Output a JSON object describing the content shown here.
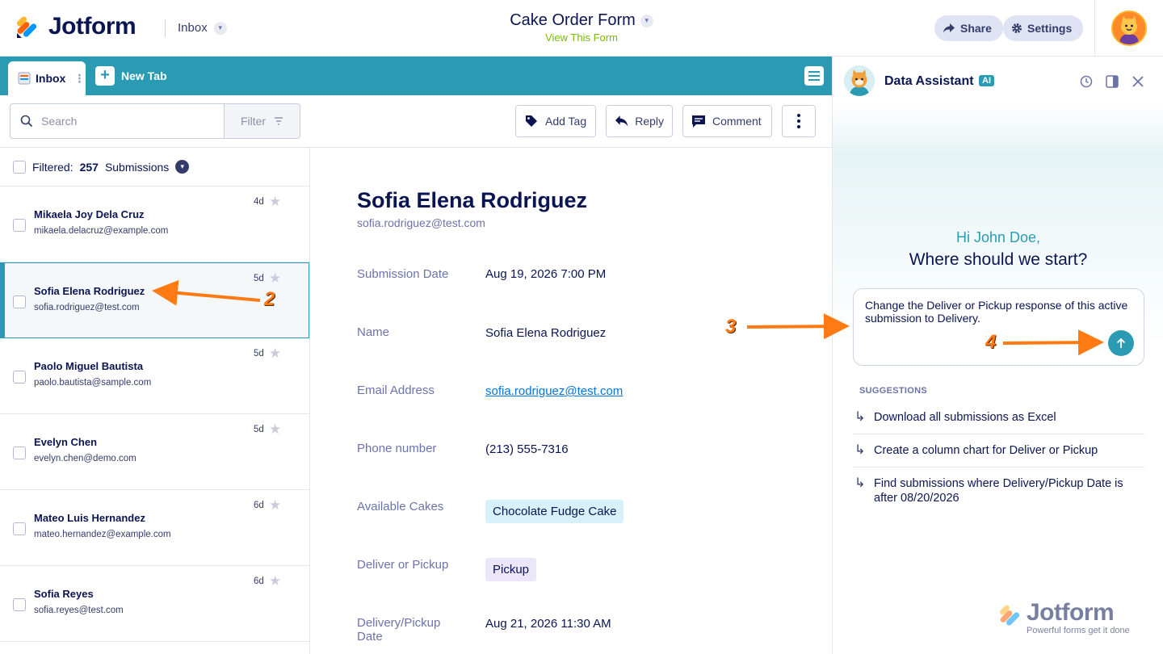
{
  "header": {
    "brand": "Jotform",
    "inbox_label": "Inbox",
    "form_title": "Cake Order Form",
    "view_form": "View This Form",
    "share_label": "Share",
    "settings_label": "Settings"
  },
  "tabs": {
    "active_label": "Inbox",
    "new_tab_label": "New Tab"
  },
  "toolbar": {
    "search_placeholder": "Search",
    "filter_label": "Filter",
    "add_tag_label": "Add Tag",
    "reply_label": "Reply",
    "comment_label": "Comment"
  },
  "list": {
    "filtered_prefix": "Filtered:",
    "count": "257",
    "submissions_suffix": "Submissions",
    "items": [
      {
        "name": "Mikaela Joy Dela Cruz",
        "email": "mikaela.delacruz@example.com",
        "age": "4d"
      },
      {
        "name": "Sofia Elena Rodriguez",
        "email": "sofia.rodriguez@test.com",
        "age": "5d"
      },
      {
        "name": "Paolo Miguel Bautista",
        "email": "paolo.bautista@sample.com",
        "age": "5d"
      },
      {
        "name": "Evelyn Chen",
        "email": "evelyn.chen@demo.com",
        "age": "5d"
      },
      {
        "name": "Mateo Luis Hernandez",
        "email": "mateo.hernandez@example.com",
        "age": "6d"
      },
      {
        "name": "Sofia Reyes",
        "email": "sofia.reyes@test.com",
        "age": "6d"
      }
    ]
  },
  "detail": {
    "name": "Sofia Elena Rodriguez",
    "email": "sofia.rodriguez@test.com",
    "fields": [
      {
        "label": "Submission Date",
        "value": "Aug 19, 2026 7:00 PM"
      },
      {
        "label": "Name",
        "value": "Sofia Elena Rodriguez"
      },
      {
        "label": "Email Address",
        "value": "sofia.rodriguez@test.com"
      },
      {
        "label": "Phone number",
        "value": "(213) 555-7316"
      },
      {
        "label": "Available Cakes",
        "value": "Chocolate Fudge Cake"
      },
      {
        "label": "Deliver or Pickup",
        "value": "Pickup"
      },
      {
        "label": "Delivery/Pickup Date",
        "value": "Aug 21, 2026 11:30 AM"
      }
    ],
    "chip_colors": {
      "cake": "#d6f1fa",
      "pickup": "#ece6fb"
    }
  },
  "assistant": {
    "title": "Data Assistant",
    "badge": "AI",
    "greeting": "Hi John Doe,",
    "question": "Where should we start?",
    "prompt_text": "Change the Deliver or Pickup response of this active submission to Delivery.",
    "suggestions_title": "SUGGESTIONS",
    "suggestions": [
      "Download all submissions as Excel",
      "Create a column chart for Deliver or Pickup",
      "Find submissions where Delivery/Pickup Date is after 08/20/2026"
    ],
    "watermark": "Jotform",
    "watermark_sub": "Powerful forms get it done"
  },
  "annotations": [
    "2",
    "3",
    "4"
  ],
  "colors": {
    "accent": "#2a9bb3",
    "navy": "#0a1551",
    "arrow": "#ff7a12",
    "green_link": "#78bb07"
  }
}
